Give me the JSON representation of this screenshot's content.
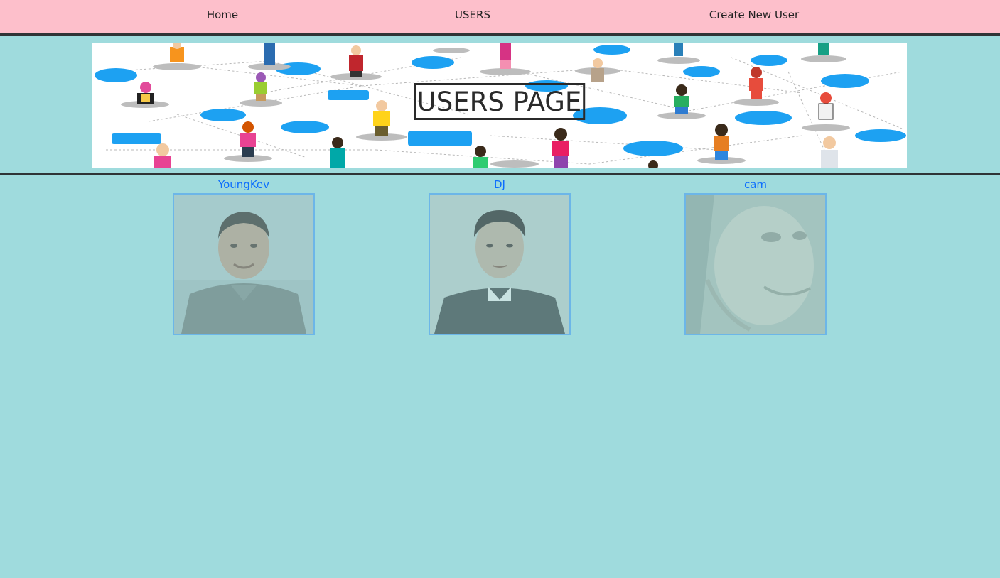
{
  "nav": {
    "home": "Home",
    "users": "USERS",
    "create": "Create New User"
  },
  "banner": {
    "title": "USERS PAGE"
  },
  "users": [
    {
      "name": "YoungKev",
      "avatar": "person-photo"
    },
    {
      "name": "DJ",
      "avatar": "person-photo"
    },
    {
      "name": "cam",
      "avatar": "person-photo"
    }
  ],
  "colors": {
    "nav_bg": "#fdbfcb",
    "page_bg": "#9fdbdd",
    "link": "#0d6efd",
    "photo_border": "#6cb6e8"
  }
}
